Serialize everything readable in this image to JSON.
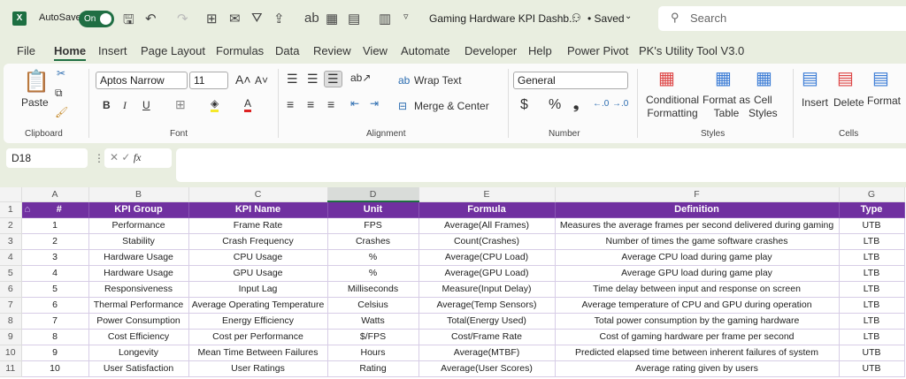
{
  "titlebar": {
    "app_icon": "X",
    "autosave_label": "AutoSave",
    "autosave_state": "On",
    "doc_title": "Gaming Hardware KPI Dashb...",
    "saved_status": "• Saved",
    "search_placeholder": "Search"
  },
  "tabs": [
    "File",
    "Home",
    "Insert",
    "Page Layout",
    "Formulas",
    "Data",
    "Review",
    "View",
    "Automate",
    "Developer",
    "Help",
    "Power Pivot",
    "PK's Utility Tool V3.0"
  ],
  "ribbon": {
    "clipboard": {
      "paste": "Paste",
      "label": "Clipboard"
    },
    "font": {
      "name": "Aptos Narrow",
      "size": "11",
      "label": "Font",
      "bold": "B",
      "italic": "I",
      "underline": "U"
    },
    "alignment": {
      "wrap": "Wrap Text",
      "merge": "Merge & Center",
      "label": "Alignment"
    },
    "number": {
      "format": "General",
      "currency": "$",
      "percent": "%",
      "comma": "❟",
      "label": "Number"
    },
    "styles": {
      "conditional": "Conditional",
      "conditional2": "Formatting",
      "format_table": "Format as",
      "format_table2": "Table",
      "cell_styles": "Cell",
      "cell_styles2": "Styles",
      "label": "Styles"
    },
    "cells": {
      "insert": "Insert",
      "delete": "Delete",
      "format": "Format",
      "label": "Cells"
    }
  },
  "formula_bar": {
    "name_box": "D18",
    "fx": "fx",
    "value": ""
  },
  "sheet": {
    "columns": [
      "A",
      "B",
      "C",
      "D",
      "E",
      "F",
      "G"
    ],
    "headers": [
      "#",
      "KPI Group",
      "KPI Name",
      "Unit",
      "Formula",
      "Definition",
      "Type"
    ],
    "rows": [
      [
        "1",
        "Performance",
        "Frame Rate",
        "FPS",
        "Average(All Frames)",
        "Measures the average frames per second delivered during gaming",
        "UTB"
      ],
      [
        "2",
        "Stability",
        "Crash Frequency",
        "Crashes",
        "Count(Crashes)",
        "Number of times the game software crashes",
        "LTB"
      ],
      [
        "3",
        "Hardware Usage",
        "CPU Usage",
        "%",
        "Average(CPU Load)",
        "Average CPU load during game play",
        "LTB"
      ],
      [
        "4",
        "Hardware Usage",
        "GPU Usage",
        "%",
        "Average(GPU Load)",
        "Average GPU load during game play",
        "LTB"
      ],
      [
        "5",
        "Responsiveness",
        "Input Lag",
        "Milliseconds",
        "Measure(Input Delay)",
        "Time delay between input and response on screen",
        "LTB"
      ],
      [
        "6",
        "Thermal Performance",
        "Average Operating Temperature",
        "Celsius",
        "Average(Temp Sensors)",
        "Average temperature of CPU and GPU during operation",
        "LTB"
      ],
      [
        "7",
        "Power Consumption",
        "Energy Efficiency",
        "Watts",
        "Total(Energy Used)",
        "Total power consumption by the gaming hardware",
        "LTB"
      ],
      [
        "8",
        "Cost Efficiency",
        "Cost per Performance",
        "$/FPS",
        "Cost/Frame Rate",
        "Cost of gaming hardware per frame per second",
        "LTB"
      ],
      [
        "9",
        "Longevity",
        "Mean Time Between Failures",
        "Hours",
        "Average(MTBF)",
        "Predicted elapsed time between inherent failures of system",
        "UTB"
      ],
      [
        "10",
        "User Satisfaction",
        "User Ratings",
        "Rating",
        "Average(User Scores)",
        "Average rating given by users",
        "UTB"
      ]
    ]
  }
}
